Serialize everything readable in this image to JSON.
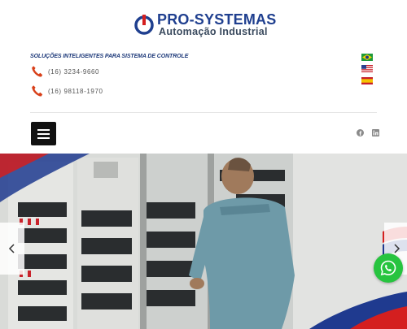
{
  "header": {
    "logo_title": "PRO-SYSTEMAS",
    "logo_subtitle": "Automação  Industrial",
    "tagline": "SOLUÇÕES INTELIGENTES PARA SISTEMA DE CONTROLE",
    "phones": [
      "(16) 3234-9660",
      "(16) 98118-1970"
    ]
  },
  "languages": [
    "pt-BR",
    "en-US",
    "es"
  ],
  "social": [
    "facebook-icon",
    "linkedin-icon"
  ],
  "colors": {
    "brand_blue": "#1f3f8f",
    "brand_red": "#d41f1f",
    "phone_icon": "#d8401a",
    "whatsapp": "#27c43f",
    "menu": "#111111"
  }
}
